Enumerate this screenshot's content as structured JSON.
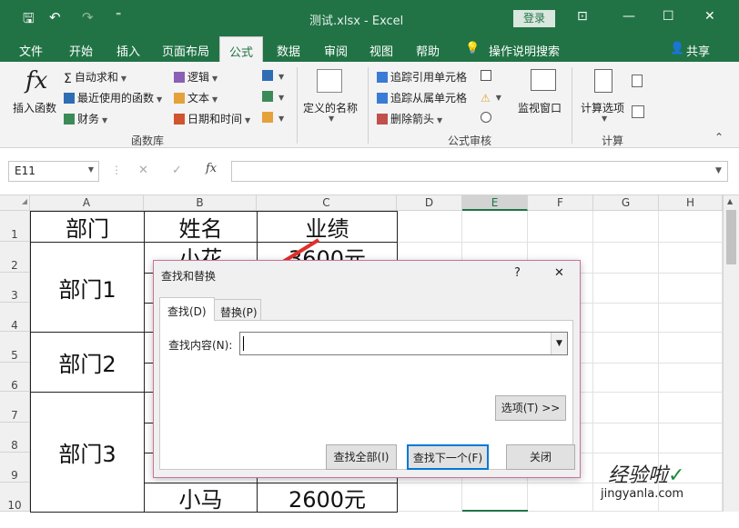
{
  "window": {
    "title": "测试.xlsx - Excel",
    "login": "登录",
    "min": "—",
    "restore": "☐",
    "close": "✕",
    "ribbon_toggle": "⊡"
  },
  "quick_access": {
    "save": "🖫",
    "undo": "↶",
    "redo": "↷",
    "more": "⁼"
  },
  "tabs": [
    "文件",
    "开始",
    "插入",
    "页面布局",
    "公式",
    "数据",
    "审阅",
    "视图",
    "帮助"
  ],
  "tell_me": "操作说明搜索",
  "share": "共享",
  "ribbon": {
    "insert_function": {
      "icon": "fx",
      "label": "插入函数"
    },
    "autosum": "自动求和",
    "recent": "最近使用的函数",
    "finance": "财务",
    "logic": "逻辑",
    "text": "文本",
    "datetime": "日期和时间",
    "group_func": "函数库",
    "define_name": "定义的名称",
    "trace_pre": "追踪引用单元格",
    "trace_dep": "追踪从属单元格",
    "remove_arrows": "删除箭头",
    "watch": "监视窗口",
    "group_audit": "公式审核",
    "calc_options": "计算选项",
    "group_calc": "计算",
    "collapse": "⌃"
  },
  "formula_bar": {
    "name": "E11",
    "cancel": "✕",
    "enter": "✓",
    "fx": "fx",
    "value": ""
  },
  "columns": [
    "A",
    "B",
    "C",
    "D",
    "E",
    "F",
    "G",
    "H"
  ],
  "rows": [
    "1",
    "2",
    "3",
    "4",
    "5",
    "6",
    "7",
    "8",
    "9",
    "10"
  ],
  "table": {
    "header": [
      "部门",
      "姓名",
      "业绩"
    ],
    "dept1": "部门1",
    "dept2": "部门2",
    "dept3": "部门3",
    "b2": "小花",
    "c2": "3600元",
    "b10": "小马",
    "c10": "2600元"
  },
  "dialog": {
    "title": "查找和替换",
    "help": "?",
    "close": "✕",
    "tab_find": "查找(D)",
    "tab_replace": "替换(P)",
    "find_label": "查找内容(N):",
    "find_value": "",
    "options": "选项(T) >>",
    "find_all": "查找全部(I)",
    "find_next": "查找下一个(F)",
    "close_btn": "关闭"
  },
  "watermark": {
    "text": "经验啦",
    "check": "✓",
    "url": "jingyanla.com"
  }
}
